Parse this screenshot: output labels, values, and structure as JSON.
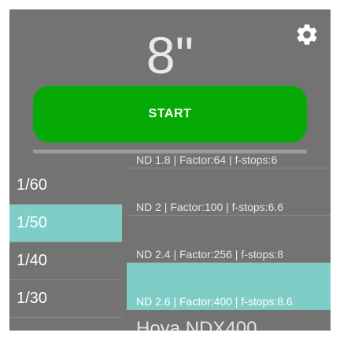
{
  "timer": {
    "display": "8\""
  },
  "settings": {
    "icon": "gear-icon"
  },
  "start_button": {
    "label": "START"
  },
  "progress": {
    "fraction": 0.0
  },
  "shutter_speeds": {
    "items": [
      "1/60",
      "1/50",
      "1/40",
      "1/30"
    ],
    "selected": "1/50"
  },
  "filters": {
    "items": [
      "ND 1.8 | Factor:64 | f-stops:6",
      "ND 2 | Factor:100 | f-stops:6.6",
      "ND 2.4 | Factor:256 | f-stops:8",
      "ND 2.6 | Factor:400 | f-stops:8.6"
    ],
    "selected": "ND 2.6 | Factor:400 | f-stops:8.6",
    "next_section_header": "Hoya NDX400"
  },
  "colors": {
    "background": "#737373",
    "accent_green": "#06aa06",
    "selection_teal": "#7ecdc7"
  }
}
